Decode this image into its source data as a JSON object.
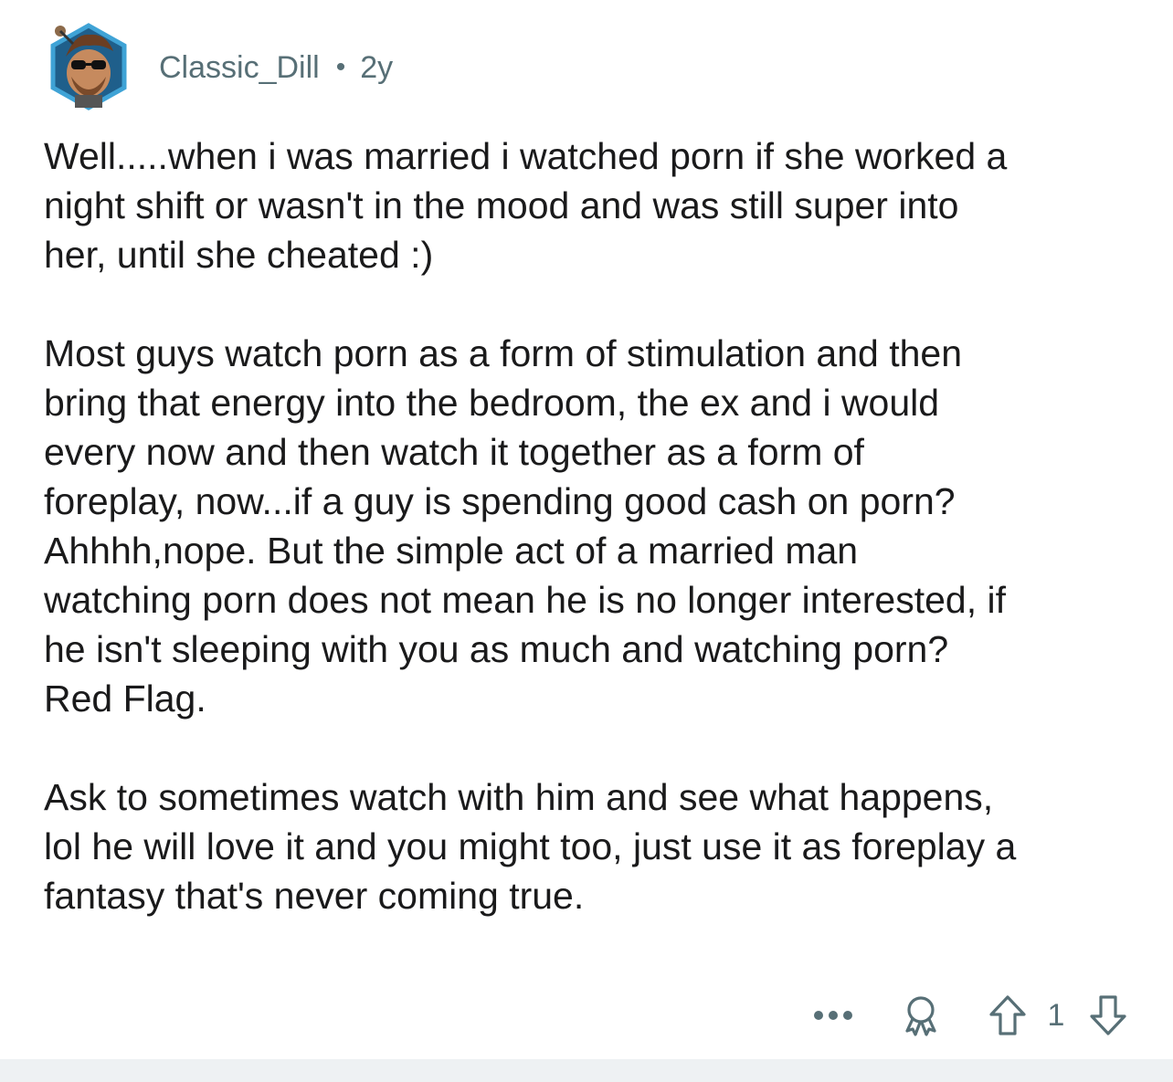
{
  "comment": {
    "username": "Classic_Dill",
    "separator": "•",
    "age": "2y",
    "paragraphs": [
      "Well.....when i was married i watched porn if she worked a\nnight shift or wasn't in the mood and was still super into\nher, until she cheated :)",
      "Most guys watch porn as a form of stimulation and then\nbring that energy into the bedroom, the ex and i would\nevery now and then watch it together as a form of\nforeplay, now...if a guy is spending good cash on porn?\nAhhhh,nope.  But the simple act of a married man\nwatching porn does not mean he is no longer interested, if\nhe isn't sleeping with you as much and watching porn?\nRed Flag.",
      "Ask to sometimes watch with him and see what happens,\nlol he will love it and you might too, just use it as foreplay a\nfantasy that's never coming true."
    ],
    "actions": {
      "more_icon": "more-horizontal-icon",
      "award_icon": "award-icon",
      "upvote_icon": "upvote-arrow-icon",
      "score": "1",
      "downvote_icon": "downvote-arrow-icon"
    }
  },
  "colors": {
    "text": "#1a1a1b",
    "meta": "#576f76",
    "footer": "#eef1f3"
  }
}
